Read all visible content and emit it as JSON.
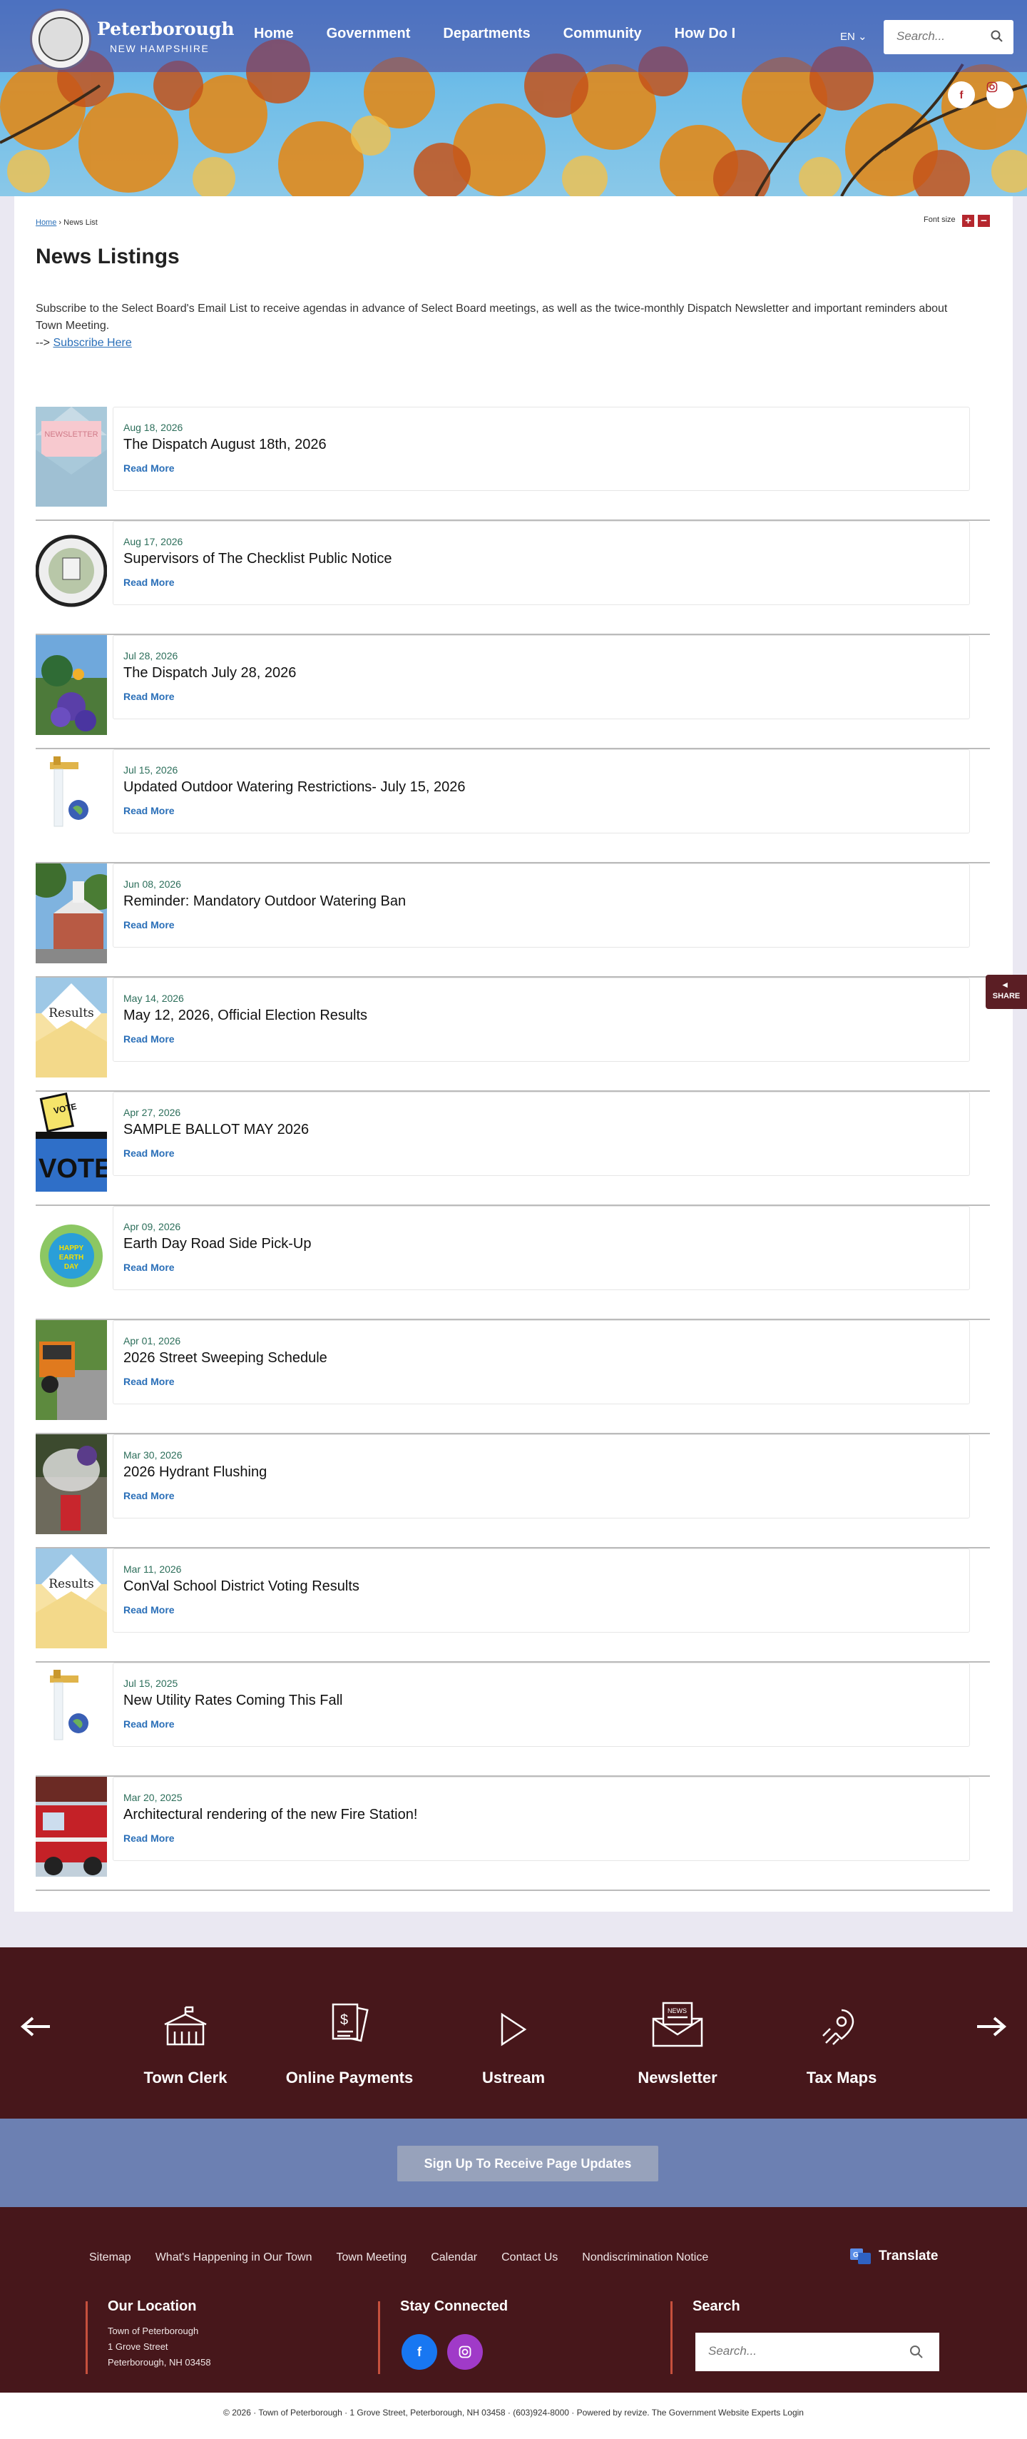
{
  "header": {
    "brand_name": "Peterborough",
    "brand_sub": "NEW HAMPSHIRE",
    "nav": [
      "Home",
      "Government",
      "Departments",
      "Community",
      "How Do I"
    ],
    "lang": "EN",
    "search_placeholder": "Search..."
  },
  "breadcrumb": {
    "home": "Home",
    "sep": "›",
    "current": "News List"
  },
  "font_size": {
    "label": "Font size",
    "plus": "+",
    "minus": "−"
  },
  "page_title": "News Listings",
  "intro": {
    "text": "Subscribe to the Select Board's Email List to receive agendas in advance of Select Board meetings, as well as the twice-monthly Dispatch Newsletter and important reminders about Town Meeting.",
    "arrow": "-->",
    "link": "Subscribe Here"
  },
  "news": [
    {
      "date": "Aug 18, 2026",
      "title": "The Dispatch August 18th, 2026",
      "more": "Read More",
      "thumb": "newsletter-envelope",
      "thumb_text": "NEWSLETTER"
    },
    {
      "date": "Aug 17, 2026",
      "title": "Supervisors of The Checklist Public Notice",
      "more": "Read More",
      "thumb": "town-seal",
      "thumb_text": ""
    },
    {
      "date": "Jul 28, 2026",
      "title": "The Dispatch July 28, 2026",
      "more": "Read More",
      "thumb": "purple-flowers",
      "thumb_text": ""
    },
    {
      "date": "Jul 15, 2026",
      "title": "Updated Outdoor Watering Restrictions- July 15, 2026",
      "more": "Read More",
      "thumb": "faucet-globe",
      "thumb_text": ""
    },
    {
      "date": "Jun 08, 2026",
      "title": "Reminder: Mandatory Outdoor Watering Ban",
      "more": "Read More",
      "thumb": "town-hall",
      "thumb_text": ""
    },
    {
      "date": "May 14, 2026",
      "title": "May 12, 2026, Official Election Results",
      "more": "Read More",
      "thumb": "results-envelope",
      "thumb_text": "Results"
    },
    {
      "date": "Apr 27, 2026",
      "title": "SAMPLE BALLOT MAY 2026",
      "more": "Read More",
      "thumb": "vote-box",
      "thumb_text": "VOTE"
    },
    {
      "date": "Apr 09, 2026",
      "title": "Earth Day Road Side Pick-Up",
      "more": "Read More",
      "thumb": "earth-day",
      "thumb_text": "HAPPY EARTH DAY"
    },
    {
      "date": "Apr 01, 2026",
      "title": "2026 Street Sweeping Schedule",
      "more": "Read More",
      "thumb": "street-sweeper",
      "thumb_text": ""
    },
    {
      "date": "Mar 30, 2026",
      "title": "2026 Hydrant Flushing",
      "more": "Read More",
      "thumb": "hydrant",
      "thumb_text": ""
    },
    {
      "date": "Mar 11, 2026",
      "title": "ConVal School District Voting Results",
      "more": "Read More",
      "thumb": "results-envelope",
      "thumb_text": "Results"
    },
    {
      "date": "Jul 15, 2025",
      "title": "New Utility Rates Coming This Fall",
      "more": "Read More",
      "thumb": "faucet-globe",
      "thumb_text": ""
    },
    {
      "date": "Mar 20, 2025",
      "title": "Architectural rendering of the new Fire Station!",
      "more": "Read More",
      "thumb": "fire-truck",
      "thumb_text": ""
    }
  ],
  "share": "SHARE",
  "quick_links": [
    {
      "label": "Town Clerk",
      "icon": "town-hall-icon"
    },
    {
      "label": "Online Payments",
      "icon": "payment-docs-icon"
    },
    {
      "label": "Ustream",
      "icon": "play-icon"
    },
    {
      "label": "Newsletter",
      "icon": "news-envelope-icon"
    },
    {
      "label": "Tax Maps",
      "icon": "map-pin-icon"
    }
  ],
  "subscribe_button": "Sign Up To Receive Page Updates",
  "footer": {
    "links": [
      "Sitemap",
      "What's Happening in Our Town",
      "Town Meeting",
      "Calendar",
      "Contact Us",
      "Nondiscrimination Notice"
    ],
    "translate": "Translate",
    "location_title": "Our Location",
    "location_lines": [
      "Town of Peterborough",
      "1 Grove Street",
      "Peterborough, NH 03458"
    ],
    "connected_title": "Stay Connected",
    "search_title": "Search",
    "search_placeholder": "Search..."
  },
  "bottom_bar": "© 2026  ·  Town of Peterborough  ·  1 Grove Street, Peterborough, NH 03458  ·  (603)924-8000  ·  Powered by revize. The Government Website Experts Login",
  "colors": {
    "brand_maroon": "#47171b",
    "accent_red": "#b5272e",
    "link_blue": "#2a6fb8",
    "date_green": "#2c6e5a",
    "subscribe_bar": "#6c80b2"
  }
}
